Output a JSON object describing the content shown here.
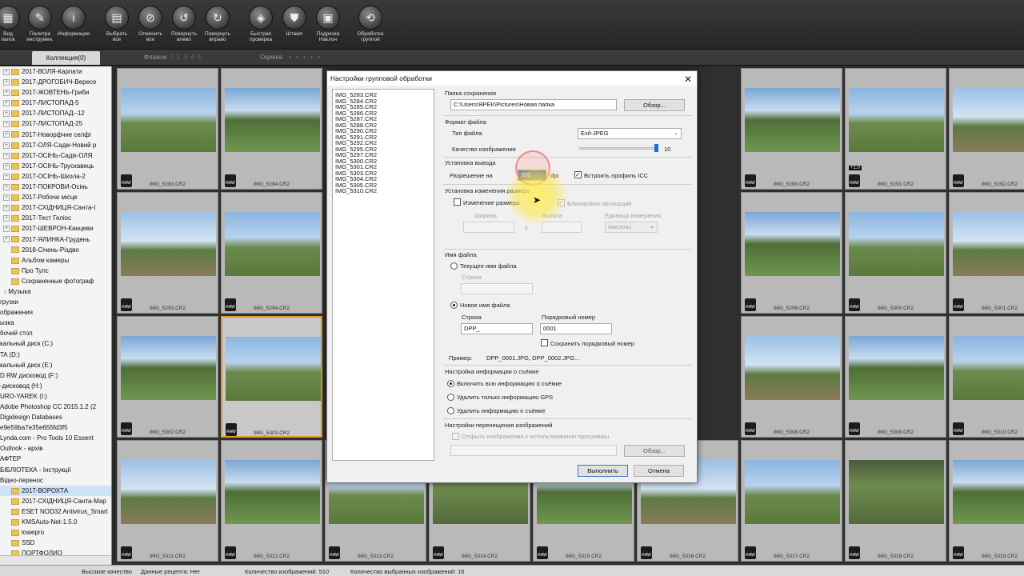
{
  "toolbar": {
    "buttons": [
      {
        "label": "Вид\nпапок",
        "icon": "folder-view-icon"
      },
      {
        "label": "Палитра\nинструмен.",
        "icon": "tool-palette-icon"
      },
      {
        "label": "Информация",
        "icon": "info-icon"
      },
      {
        "label": "Выбрать\nвсе",
        "icon": "select-all-icon"
      },
      {
        "label": "Отменить\nвсе",
        "icon": "deselect-all-icon"
      },
      {
        "label": "Повернуть\nвлево",
        "icon": "rotate-left-icon"
      },
      {
        "label": "Повернуть\nвправо",
        "icon": "rotate-right-icon"
      },
      {
        "label": "Быстрая\nпроверка",
        "icon": "quick-check-icon"
      },
      {
        "label": "Штамп",
        "icon": "stamp-icon"
      },
      {
        "label": "Подрезка\nНаклон",
        "icon": "crop-icon"
      },
      {
        "label": "Обработка\nгруппой",
        "icon": "batch-process-icon"
      }
    ]
  },
  "filterbar": {
    "collection_tab": "Коллекция(0)",
    "flag_label": "Флажок",
    "flag_values": "1 2 3 4 5",
    "rating_label": "Оценка",
    "rating_dots": "• • • • •"
  },
  "tree": {
    "rows": [
      {
        "label": "2017-ВОЛЯ-Карпати",
        "type": "folder",
        "exp": true
      },
      {
        "label": "2017-ДРОГОБИЧ-Вересе",
        "type": "folder",
        "exp": true
      },
      {
        "label": "2017-ЖОВТЕНЬ-Гриби",
        "type": "folder",
        "exp": true
      },
      {
        "label": "2017-ЛИСТОПАД-5",
        "type": "folder",
        "exp": true
      },
      {
        "label": "2017-ЛИСТОПАД--12",
        "type": "folder",
        "exp": true
      },
      {
        "label": "2017-ЛИСТОПАД-25",
        "type": "folder",
        "exp": true
      },
      {
        "label": "2017-Новорфчне селфі",
        "type": "folder",
        "exp": true
      },
      {
        "label": "2017-ОЛЯ-Садік-Новий р",
        "type": "folder",
        "exp": true
      },
      {
        "label": "2017-ОСІНЬ-Садік-ОЛЯ",
        "type": "folder",
        "exp": true
      },
      {
        "label": "2017-ОСІНЬ-Трускавець",
        "type": "folder",
        "exp": true
      },
      {
        "label": "2017-ОСІНЬ-Школа-2",
        "type": "folder",
        "exp": true
      },
      {
        "label": "2017-ПОКРОВИ-Осінь",
        "type": "folder",
        "exp": true
      },
      {
        "label": "2017-Робоче місце",
        "type": "folder",
        "exp": true
      },
      {
        "label": "2017-СХІДНИЦЯ-Санта-І",
        "type": "folder",
        "exp": true
      },
      {
        "label": "2017-Тест Геліос",
        "type": "folder",
        "exp": true
      },
      {
        "label": "2017-ШЕВРОН-Канцеви",
        "type": "folder",
        "exp": true
      },
      {
        "label": "2017-ЯЛИНКА-Грудень",
        "type": "folder",
        "exp": true
      },
      {
        "label": "2018-Січень-Різдво",
        "type": "folder",
        "exp": false
      },
      {
        "label": "Альбом камеры",
        "type": "folder",
        "exp": false
      },
      {
        "label": "Про Тулс",
        "type": "folder",
        "exp": false
      },
      {
        "label": "Сохраненные фотограф",
        "type": "folder",
        "exp": false
      },
      {
        "label": "Музыка",
        "type": "music",
        "exp": false
      },
      {
        "label": "грузки",
        "type": "plain",
        "exp": false
      },
      {
        "label": "ображения",
        "type": "plain",
        "exp": false
      },
      {
        "label": "ызка",
        "type": "plain",
        "exp": false
      },
      {
        "label": "бочий стол",
        "type": "plain",
        "exp": false
      },
      {
        "label": "кальный диск (C:)",
        "type": "plain",
        "exp": false
      },
      {
        "label": "TA (D:)",
        "type": "plain",
        "exp": false
      },
      {
        "label": "кальный диск (E:)",
        "type": "plain",
        "exp": false
      },
      {
        "label": "D RW дисковод (F:)",
        "type": "plain",
        "exp": false
      },
      {
        "label": "-дисковод (H:)",
        "type": "plain",
        "exp": false
      },
      {
        "label": "URO-YAREK (I:)",
        "type": "plain",
        "exp": false
      },
      {
        "label": "Adobe Photoshop CC 2015.1.2 (2",
        "type": "plain",
        "exp": false
      },
      {
        "label": "Digidesign Databases",
        "type": "plain",
        "exp": false
      },
      {
        "label": "e9e59ba7e35e655fd3f5",
        "type": "plain",
        "exp": false
      },
      {
        "label": "Lynda.com - Pro Tools 10 Essent",
        "type": "plain",
        "exp": false
      },
      {
        "label": "Outlook - архів",
        "type": "plain",
        "exp": false
      },
      {
        "label": "АФТЕР",
        "type": "plain",
        "exp": false
      },
      {
        "label": "БІБЛІОТЕКА - Інструкції",
        "type": "plain",
        "exp": false
      },
      {
        "label": "Відео-перенос",
        "type": "plain",
        "exp": false
      },
      {
        "label": "2017-ВОРОХТА",
        "type": "folder",
        "exp": false,
        "sel": true
      },
      {
        "label": "2017-СХІДНИЦЯ-Санта-Мар",
        "type": "folder",
        "exp": false
      },
      {
        "label": "ESET NOD32 Antivirus_Smart",
        "type": "folder",
        "exp": false
      },
      {
        "label": "KMSAuto-Net-1.5.0",
        "type": "folder",
        "exp": false
      },
      {
        "label": "lowepro",
        "type": "folder",
        "exp": false
      },
      {
        "label": "SSD",
        "type": "folder",
        "exp": false
      },
      {
        "label": "ПОРТФОЛИО",
        "type": "folder",
        "exp": false
      }
    ]
  },
  "thumbs": [
    {
      "name": "",
      "row": 0,
      "col": 0,
      "v": 3
    },
    {
      "name": "IMG_5283.CR2",
      "row": 0,
      "col": 0,
      "v": 0
    },
    {
      "name": "IMG_5284.CR2",
      "row": 0,
      "col": 1,
      "v": 1
    },
    {
      "name": "IMG_5290.CR2",
      "row": 0,
      "col": 6,
      "v": 1
    },
    {
      "name": "IMG_5291.CR2",
      "row": 0,
      "col": 7,
      "v": 0,
      "badge": "+1.0"
    },
    {
      "name": "IMG_5292.CR2",
      "row": 0,
      "col": 8,
      "v": 2
    },
    {
      "name": "IMG_5293.CR2",
      "row": 1,
      "col": 0,
      "v": 2
    },
    {
      "name": "IMG_5294.CR2",
      "row": 1,
      "col": 1,
      "v": 0
    },
    {
      "name": "IMG_5299.CR2",
      "row": 1,
      "col": 6,
      "v": 1
    },
    {
      "name": "IMG_5300.CR2",
      "row": 1,
      "col": 7,
      "v": 0
    },
    {
      "name": "IMG_5301.CR2",
      "row": 1,
      "col": 8,
      "v": 2
    },
    {
      "name": "IMG_5302.CR2",
      "row": 2,
      "col": 0,
      "v": 1
    },
    {
      "name": "IMG_5303.CR2",
      "row": 2,
      "col": 1,
      "v": 0,
      "selected": true
    },
    {
      "name": "IMG_5308.CR2",
      "row": 2,
      "col": 6,
      "v": 2
    },
    {
      "name": "IMG_5309.CR2",
      "row": 2,
      "col": 7,
      "v": 1
    },
    {
      "name": "IMG_5310.CR2",
      "row": 2,
      "col": 8,
      "v": 0
    },
    {
      "name": "IMG_5311.CR2",
      "row": 3,
      "col": 0,
      "v": 2
    },
    {
      "name": "IMG_5312.CR2",
      "row": 3,
      "col": 1,
      "v": 1
    },
    {
      "name": "IMG_5313.CR2",
      "row": 3,
      "col": 2,
      "v": 0
    },
    {
      "name": "IMG_5314.CR2",
      "row": 3,
      "col": 3,
      "v": 3
    },
    {
      "name": "IMG_5315.CR2",
      "row": 3,
      "col": 4,
      "v": 1
    },
    {
      "name": "IMG_5316.CR2",
      "row": 3,
      "col": 5,
      "v": 2
    },
    {
      "name": "IMG_5317.CR2",
      "row": 3,
      "col": 6,
      "v": 0
    },
    {
      "name": "IMG_5318.CR2",
      "row": 3,
      "col": 7,
      "v": 3
    },
    {
      "name": "IMG_5319.CR2",
      "row": 3,
      "col": 8,
      "v": 1
    },
    {
      "name": "",
      "row": 0,
      "col": 5,
      "v": 1
    },
    {
      "name": "",
      "row": 1,
      "col": 5,
      "v": 3
    },
    {
      "name": "",
      "row": 2,
      "col": 5,
      "v": 2
    }
  ],
  "status": {
    "quality": "Высокое качество",
    "recipe": "Данные рецепта: Нет",
    "count": "Количество изображений: 510",
    "selected": "Количество выбранных изображений: 16"
  },
  "dialog": {
    "title": "Настройки групповой обработки",
    "files": [
      "IMG_5283.CR2",
      "IMG_5284.CR2",
      "IMG_5285.CR2",
      "IMG_5286.CR2",
      "IMG_5287.CR2",
      "IMG_5288.CR2",
      "IMG_5290.CR2",
      "IMG_5291.CR2",
      "IMG_5292.CR2",
      "IMG_5295.CR2",
      "IMG_5297.CR2",
      "IMG_5300.CR2",
      "IMG_5301.CR2",
      "IMG_5303.CR2",
      "IMG_5304.CR2",
      "IMG_5305.CR2",
      "IMG_5310.CR2"
    ],
    "save_folder": {
      "label": "Папка сохранения",
      "path": "C:\\Users\\ЯРЕК\\Pictures\\Новая папка",
      "browse": "Обзор..."
    },
    "file_format": {
      "label": "Формат файла",
      "type_label": "Тип файла",
      "type_value": "Exif-JPEG",
      "quality_label": "Качество изображения",
      "quality_value": "10",
      "quality_level": 0.97
    },
    "output": {
      "label": "Установка вывода",
      "resolution_label": "Разрешение на",
      "resolution_value": "350",
      "dpi": "dpi",
      "icc_label": "Встроить профиль ICC",
      "icc_checked": true
    },
    "resize": {
      "label": "Установка изменения размера",
      "resize_label": "Изменение размера",
      "lock_label": "Блокировка пропорций",
      "width_label": "Ширина",
      "height_label": "Высота",
      "times": "x",
      "unit_label": "Единица измерения",
      "unit_value": "пикселы"
    },
    "filename": {
      "label": "Имя файла",
      "current_label": "Текущее имя файла",
      "string_label_dis": "Строка",
      "new_label": "Новое имя файла",
      "string_label": "Строка",
      "string_value": "DPP_",
      "seq_label": "Порядковый номер",
      "seq_value": "0001",
      "keep_seq_label": "Сохранить порядковый номер",
      "example_label": "Пример:",
      "example_value": "DPP_0001.JPG, DPP_0002.JPG..."
    },
    "shooting_info": {
      "label": "Настройка информации о съёмке",
      "opt1": "Включить всю информацию о съёмке",
      "opt2": "Удалить только информацию GPS",
      "opt3": "Удалить информацию о съёмке"
    },
    "transfer": {
      "label": "Настройки перенещения изображений",
      "open_label": "Открыть изображения с использованием программы",
      "browse": "Обзор..."
    },
    "execute": "Выполнить",
    "cancel": "Отмена"
  }
}
